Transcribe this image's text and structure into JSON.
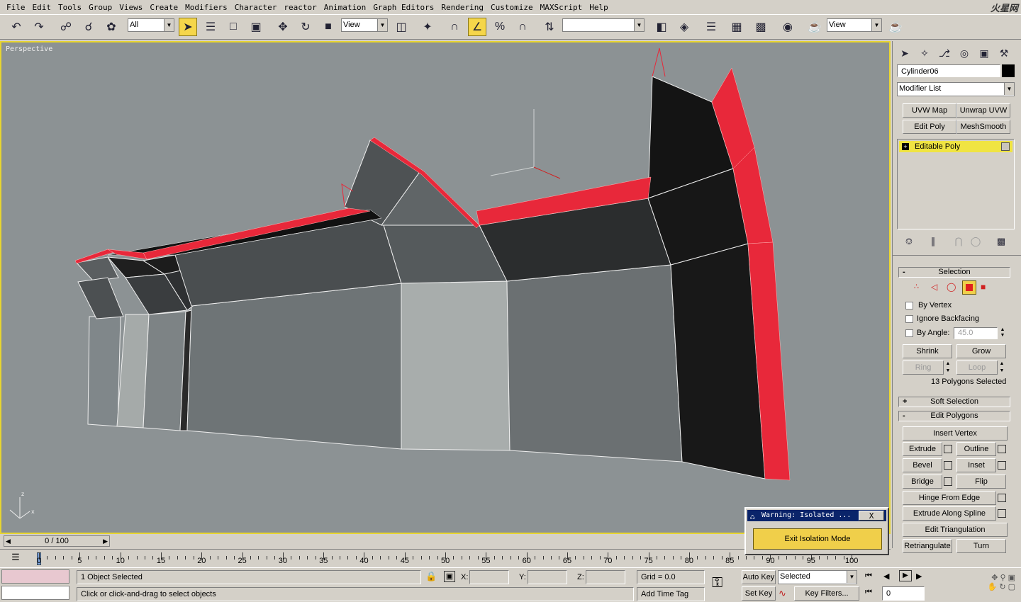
{
  "menu": [
    "File",
    "Edit",
    "Tools",
    "Group",
    "Views",
    "Create",
    "Modifiers",
    "Character",
    "reactor",
    "Animation",
    "Graph Editors",
    "Rendering",
    "Customize",
    "MAXScript",
    "Help"
  ],
  "logo": "火星网",
  "toolbar": {
    "selection_filter": "All",
    "ref_coord_1": "View",
    "named_selection": "",
    "ref_coord_2": "View"
  },
  "viewport": {
    "label": "Perspective",
    "axis_labels": {
      "z": "z",
      "x": "x"
    }
  },
  "command_panel": {
    "object_name": "Cylinder06",
    "modifier_list": "Modifier List",
    "modifier_buttons": [
      "UVW Map",
      "Unwrap UVW",
      "Edit Poly",
      "MeshSmooth"
    ],
    "stack_item": "Editable Poly",
    "selection_rollout": {
      "title": "Selection",
      "by_vertex": "By Vertex",
      "ignore_backfacing": "Ignore Backfacing",
      "by_angle": "By Angle:",
      "angle_value": "45.0",
      "shrink": "Shrink",
      "grow": "Grow",
      "ring": "Ring",
      "loop": "Loop",
      "status": "13 Polygons Selected"
    },
    "soft_selection_title": "Soft Selection",
    "edit_polygons": {
      "title": "Edit Polygons",
      "insert_vertex": "Insert Vertex",
      "extrude": "Extrude",
      "outline": "Outline",
      "bevel": "Bevel",
      "inset": "Inset",
      "bridge": "Bridge",
      "flip": "Flip",
      "hinge": "Hinge From Edge",
      "extrude_spline": "Extrude Along Spline",
      "edit_triangulation": "Edit Triangulation",
      "retriangulate": "Retriangulate",
      "turn": "Turn"
    }
  },
  "timeline": {
    "slider": "0 / 100",
    "ticks": [
      "0",
      "5",
      "10",
      "15",
      "20",
      "25",
      "30",
      "35",
      "40",
      "45",
      "50",
      "55",
      "60",
      "65",
      "70",
      "75",
      "80",
      "85",
      "90",
      "95",
      "100"
    ]
  },
  "status": {
    "selected": "1 Object Selected",
    "prompt": "Click or click-and-drag to select objects",
    "x_label": "X:",
    "y_label": "Y:",
    "z_label": "Z:",
    "grid": "Grid = 0.0",
    "add_time_tag": "Add Time Tag",
    "auto_key": "Auto Key",
    "set_key": "Set Key",
    "key_mode": "Selected",
    "key_filters": "Key Filters...",
    "frame": "0"
  },
  "isolate_dialog": {
    "title": "Warning: Isolated ...",
    "close": "X",
    "button": "Exit Isolation Mode"
  },
  "colors": {
    "viewport_bg": "#8c9294",
    "viewport_border": "#e8d530",
    "selected_poly": "#e8283a",
    "dark_poly": "#1a1a1a",
    "gray_poly": "#4a4e50",
    "light_poly": "#a8adac"
  },
  "icons": [
    "undo-icon",
    "redo-icon",
    "link-icon",
    "unlink-icon",
    "bind-icon",
    "select-icon",
    "select-by-name-icon",
    "rect-region-icon",
    "window-crossing-icon",
    "move-icon",
    "rotate-icon",
    "scale-icon",
    "pivot-icon",
    "manipulate-icon",
    "snap-icon",
    "angle-snap-icon",
    "percent-snap-icon",
    "spinner-snap-icon",
    "named-selection-icon",
    "mirror-icon",
    "align-icon",
    "layers-icon",
    "curve-editor-icon",
    "schematic-icon",
    "material-editor-icon",
    "render-setup-icon",
    "quick-render-icon",
    "teapot-icon"
  ]
}
